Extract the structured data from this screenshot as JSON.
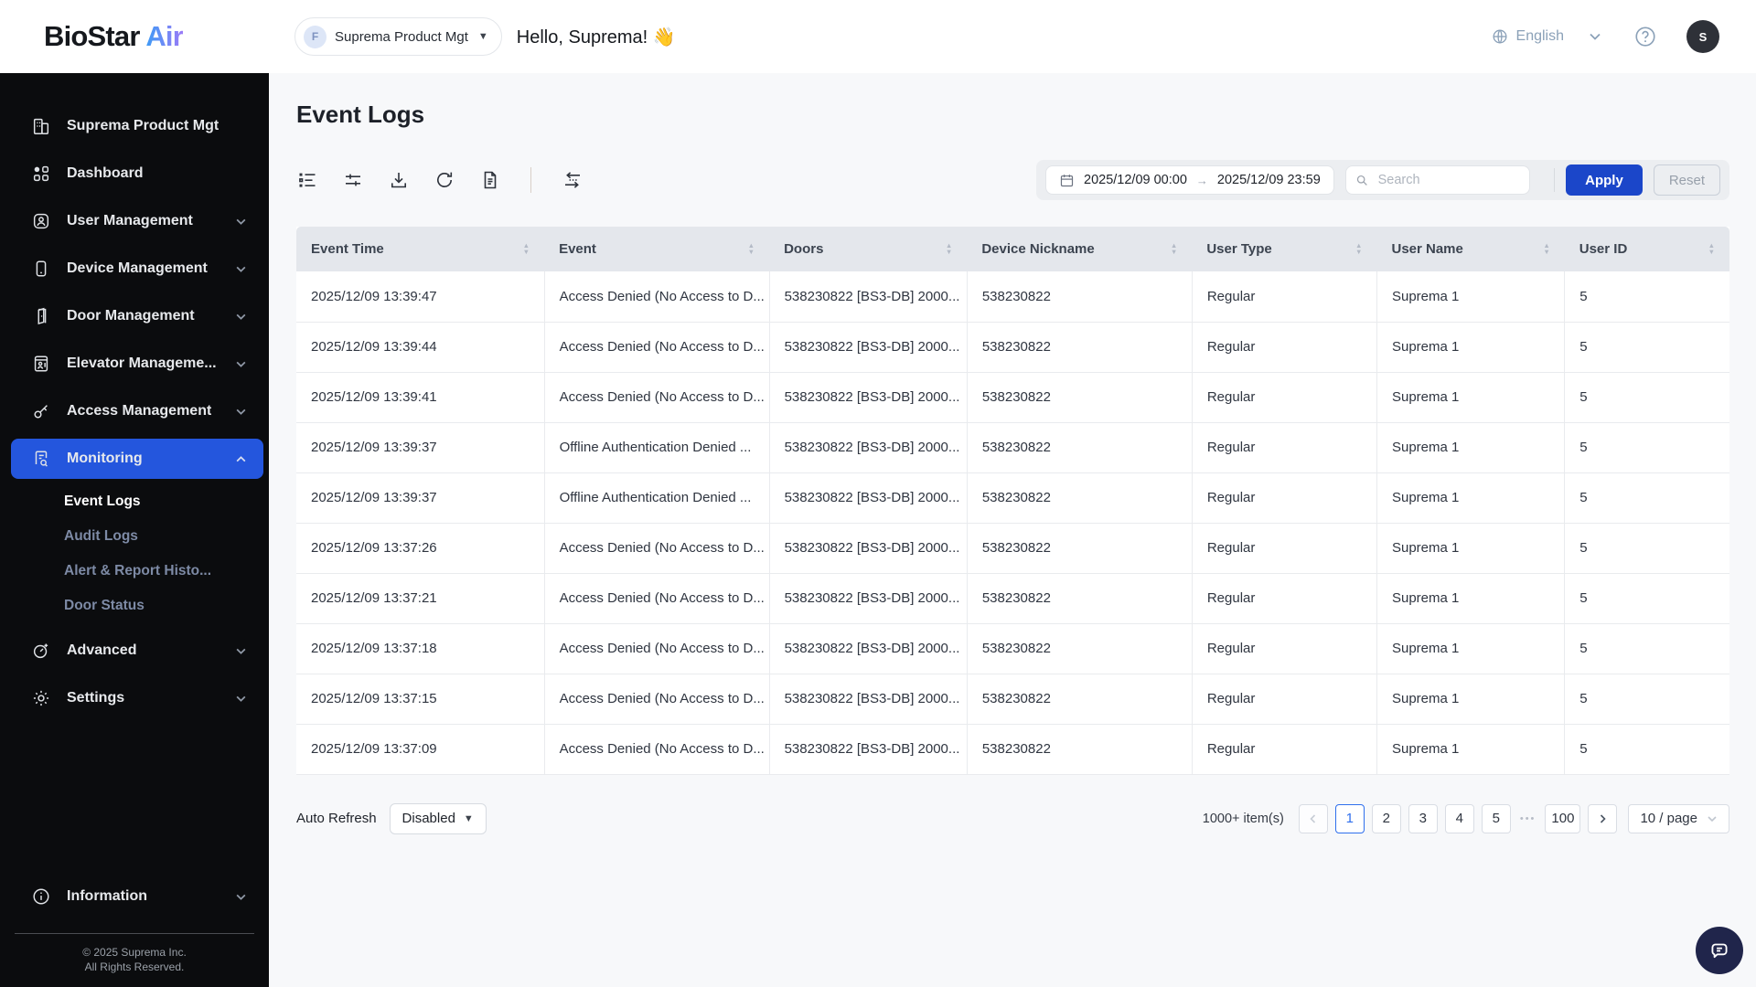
{
  "header": {
    "logo_primary": "BioStar",
    "logo_secondary": "Air",
    "org_selector": {
      "badge": "F",
      "label": "Suprema Product Mgt"
    },
    "greeting": "Hello, Suprema! 👋",
    "language": "English",
    "avatar_initial": "S"
  },
  "sidebar": {
    "items": [
      {
        "label": "Suprema Product Mgt",
        "icon": "building-icon"
      },
      {
        "label": "Dashboard",
        "icon": "dashboard-icon"
      },
      {
        "label": "User Management",
        "icon": "user-icon"
      },
      {
        "label": "Device Management",
        "icon": "device-icon"
      },
      {
        "label": "Door Management",
        "icon": "door-icon"
      },
      {
        "label": "Elevator Manageme...",
        "icon": "elevator-icon"
      },
      {
        "label": "Access Management",
        "icon": "key-icon"
      },
      {
        "label": "Monitoring",
        "icon": "monitoring-icon"
      },
      {
        "label": "Advanced",
        "icon": "advanced-icon"
      },
      {
        "label": "Settings",
        "icon": "gear-icon"
      },
      {
        "label": "Information",
        "icon": "info-icon"
      }
    ],
    "monitoring_children": [
      "Event Logs",
      "Audit Logs",
      "Alert & Report Histo...",
      "Door Status"
    ],
    "copyright_line1": "© 2025 Suprema Inc.",
    "copyright_line2": "All Rights Reserved."
  },
  "main": {
    "title": "Event Logs",
    "filters": {
      "date_from": "2025/12/09 00:00",
      "date_to": "2025/12/09 23:59",
      "range_arrow": "→",
      "search_placeholder": "Search",
      "apply_label": "Apply",
      "reset_label": "Reset"
    },
    "table": {
      "columns": [
        {
          "key": "event_time",
          "label": "Event Time"
        },
        {
          "key": "event",
          "label": "Event"
        },
        {
          "key": "doors",
          "label": "Doors"
        },
        {
          "key": "device_nickname",
          "label": "Device Nickname"
        },
        {
          "key": "user_type",
          "label": "User Type"
        },
        {
          "key": "user_name",
          "label": "User Name"
        },
        {
          "key": "user_id",
          "label": "User ID"
        }
      ],
      "rows": [
        {
          "event_time": "2025/12/09 13:39:47",
          "event": "Access Denied (No Access to D...",
          "doors": "538230822 [BS3-DB] 2000...",
          "device_nickname": "538230822",
          "user_type": "Regular",
          "user_name": "Suprema 1",
          "user_id": "5"
        },
        {
          "event_time": "2025/12/09 13:39:44",
          "event": "Access Denied (No Access to D...",
          "doors": "538230822 [BS3-DB] 2000...",
          "device_nickname": "538230822",
          "user_type": "Regular",
          "user_name": "Suprema 1",
          "user_id": "5"
        },
        {
          "event_time": "2025/12/09 13:39:41",
          "event": "Access Denied (No Access to D...",
          "doors": "538230822 [BS3-DB] 2000...",
          "device_nickname": "538230822",
          "user_type": "Regular",
          "user_name": "Suprema 1",
          "user_id": "5"
        },
        {
          "event_time": "2025/12/09 13:39:37",
          "event": "Offline Authentication Denied ...",
          "doors": "538230822 [BS3-DB] 2000...",
          "device_nickname": "538230822",
          "user_type": "Regular",
          "user_name": "Suprema 1",
          "user_id": "5"
        },
        {
          "event_time": "2025/12/09 13:39:37",
          "event": "Offline Authentication Denied ...",
          "doors": "538230822 [BS3-DB] 2000...",
          "device_nickname": "538230822",
          "user_type": "Regular",
          "user_name": "Suprema 1",
          "user_id": "5"
        },
        {
          "event_time": "2025/12/09 13:37:26",
          "event": "Access Denied (No Access to D...",
          "doors": "538230822 [BS3-DB] 2000...",
          "device_nickname": "538230822",
          "user_type": "Regular",
          "user_name": "Suprema 1",
          "user_id": "5"
        },
        {
          "event_time": "2025/12/09 13:37:21",
          "event": "Access Denied (No Access to D...",
          "doors": "538230822 [BS3-DB] 2000...",
          "device_nickname": "538230822",
          "user_type": "Regular",
          "user_name": "Suprema 1",
          "user_id": "5"
        },
        {
          "event_time": "2025/12/09 13:37:18",
          "event": "Access Denied (No Access to D...",
          "doors": "538230822 [BS3-DB] 2000...",
          "device_nickname": "538230822",
          "user_type": "Regular",
          "user_name": "Suprema 1",
          "user_id": "5"
        },
        {
          "event_time": "2025/12/09 13:37:15",
          "event": "Access Denied (No Access to D...",
          "doors": "538230822 [BS3-DB] 2000...",
          "device_nickname": "538230822",
          "user_type": "Regular",
          "user_name": "Suprema 1",
          "user_id": "5"
        },
        {
          "event_time": "2025/12/09 13:37:09",
          "event": "Access Denied (No Access to D...",
          "doors": "538230822 [BS3-DB] 2000...",
          "device_nickname": "538230822",
          "user_type": "Regular",
          "user_name": "Suprema 1",
          "user_id": "5"
        }
      ]
    },
    "footer": {
      "auto_refresh_label": "Auto Refresh",
      "auto_refresh_value": "Disabled"
    },
    "pagination": {
      "items_count": "1000+ item(s)",
      "pages": [
        "1",
        "2",
        "3",
        "4",
        "5"
      ],
      "current_page": "1",
      "ellipsis": "•••",
      "last_page": "100",
      "page_size": "10 / page"
    }
  },
  "colors": {
    "accent_blue": "#2456dd",
    "apply_blue": "#1b46c9",
    "active_page_blue": "#2f6fed",
    "sidebar_bg": "#0b0c0e",
    "table_header_bg": "#e4e7ec",
    "filter_panel_bg": "#eceef1",
    "chat_fab_bg": "#20254b"
  }
}
